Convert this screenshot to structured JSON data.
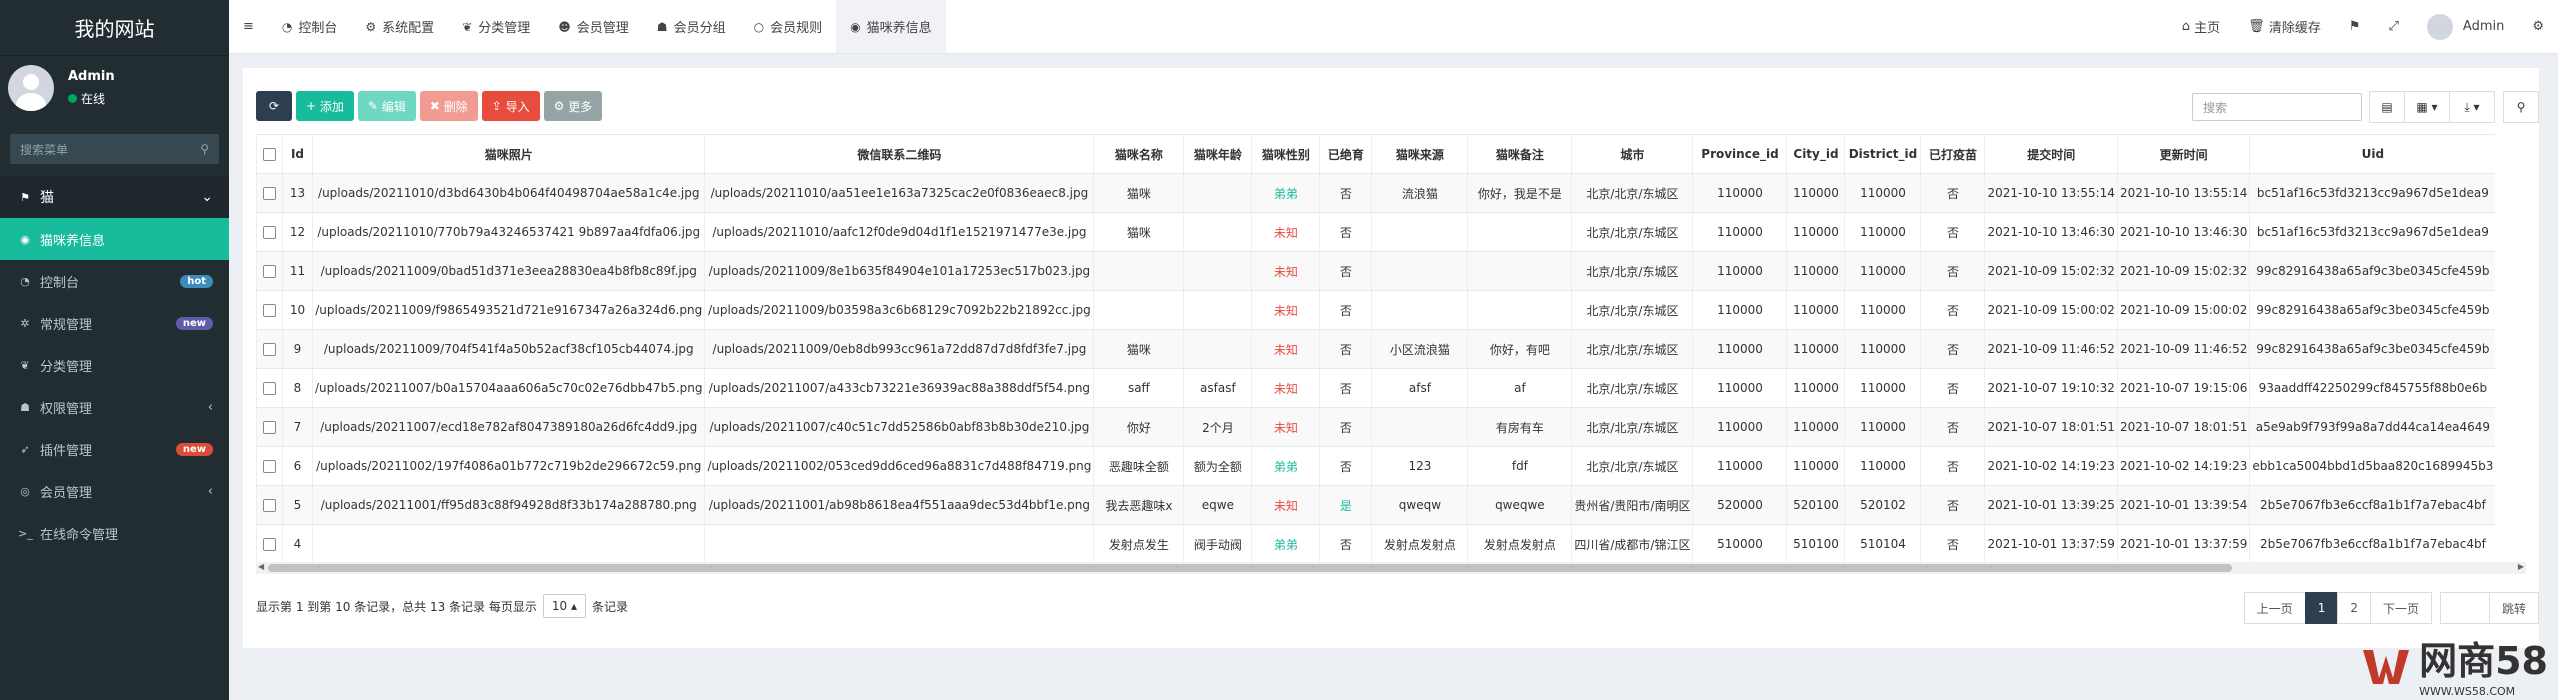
{
  "sidebar": {
    "site_title": "我的网站",
    "user": {
      "name": "Admin",
      "status": "在线"
    },
    "search_placeholder": "搜索菜单",
    "items": [
      {
        "label": "猫",
        "icon": "cat-icon",
        "glyph": "⚑"
      },
      {
        "label": "猫咪养信息",
        "icon": "wechat-icon",
        "glyph": "◉"
      },
      {
        "label": "控制台",
        "icon": "dashboard-icon",
        "glyph": "◔",
        "badge": "hot",
        "badge_color": "#3c8dbc"
      },
      {
        "label": "常规管理",
        "icon": "cogs-icon",
        "glyph": "✲",
        "badge": "new",
        "badge_color": "#605ca8"
      },
      {
        "label": "分类管理",
        "icon": "leaf-icon",
        "glyph": "❦"
      },
      {
        "label": "权限管理",
        "icon": "group-icon",
        "glyph": "☗"
      },
      {
        "label": "插件管理",
        "icon": "rocket-icon",
        "glyph": "➶",
        "badge": "new",
        "badge_color": "#dd4b39"
      },
      {
        "label": "会员管理",
        "icon": "user-circle-icon",
        "glyph": "◎"
      },
      {
        "label": "在线命令管理",
        "icon": "terminal-icon",
        "glyph": ">_"
      }
    ]
  },
  "topnav": {
    "tabs": [
      {
        "label": "控制台",
        "icon": "dashboard-icon",
        "glyph": "◔"
      },
      {
        "label": "系统配置",
        "icon": "gear-icon",
        "glyph": "⚙"
      },
      {
        "label": "分类管理",
        "icon": "leaf-icon",
        "glyph": "❦"
      },
      {
        "label": "会员管理",
        "icon": "user-icon",
        "glyph": "☻"
      },
      {
        "label": "会员分组",
        "icon": "users-icon",
        "glyph": "☗"
      },
      {
        "label": "会员规则",
        "icon": "circle-icon",
        "glyph": "○"
      },
      {
        "label": "猫咪养信息",
        "icon": "wechat-icon",
        "glyph": "◉"
      }
    ],
    "right": {
      "home": "主页",
      "clear_cache": "清除缓存",
      "admin": "Admin"
    }
  },
  "toolbar": {
    "add": "添加",
    "edit": "编辑",
    "delete": "删除",
    "import": "导入",
    "more": "更多",
    "search_placeholder": "搜索"
  },
  "table": {
    "columns": [
      "Id",
      "猫咪照片",
      "微信联系二维码",
      "猫咪名称",
      "猫咪年龄",
      "猫咪性别",
      "已绝育",
      "猫咪来源",
      "猫咪备注",
      "城市",
      "Province_id",
      "City_id",
      "District_id",
      "已打疫苗",
      "提交时间",
      "更新时间",
      "Uid"
    ],
    "rows": [
      [
        "13",
        "/uploads/20211010/d3bd6430b4b064f40498704ae58a1c4e.jpg",
        "/uploads/20211010/aa51ee1e163a7325cac2e0f0836eaec8.jpg",
        "猫咪",
        "",
        "弟弟",
        "否",
        "流浪猫",
        "你好，我是不是",
        "北京/北京/东城区",
        "110000",
        "110000",
        "110000",
        "否",
        "2021-10-10 13:55:14",
        "2021-10-10 13:55:14",
        "bc51af16c53fd3213cc9a967d5e1dea9"
      ],
      [
        "12",
        "/uploads/20211010/770b79a43246537421 9b897aa4fdfa06.jpg",
        "/uploads/20211010/aafc12f0de9d04d1f1e1521971477e3e.jpg",
        "猫咪",
        "",
        "未知",
        "否",
        "",
        "",
        "北京/北京/东城区",
        "110000",
        "110000",
        "110000",
        "否",
        "2021-10-10 13:46:30",
        "2021-10-10 13:46:30",
        "bc51af16c53fd3213cc9a967d5e1dea9"
      ],
      [
        "11",
        "/uploads/20211009/0bad51d371e3eea28830ea4b8fb8c89f.jpg",
        "/uploads/20211009/8e1b635f84904e101a17253ec517b023.jpg",
        "",
        "",
        "未知",
        "否",
        "",
        "",
        "北京/北京/东城区",
        "110000",
        "110000",
        "110000",
        "否",
        "2021-10-09 15:02:32",
        "2021-10-09 15:02:32",
        "99c82916438a65af9c3be0345cfe459b"
      ],
      [
        "10",
        "/uploads/20211009/f9865493521d721e9167347a26a324d6.png",
        "/uploads/20211009/b03598a3c6b68129c7092b22b21892cc.jpg",
        "",
        "",
        "未知",
        "否",
        "",
        "",
        "北京/北京/东城区",
        "110000",
        "110000",
        "110000",
        "否",
        "2021-10-09 15:00:02",
        "2021-10-09 15:00:02",
        "99c82916438a65af9c3be0345cfe459b"
      ],
      [
        "9",
        "/uploads/20211009/704f541f4a50b52acf38cf105cb44074.jpg",
        "/uploads/20211009/0eb8db993cc961a72dd87d7d8fdf3fe7.jpg",
        "猫咪",
        "",
        "未知",
        "否",
        "小区流浪猫",
        "你好，有吧",
        "北京/北京/东城区",
        "110000",
        "110000",
        "110000",
        "否",
        "2021-10-09 11:46:52",
        "2021-10-09 11:46:52",
        "99c82916438a65af9c3be0345cfe459b"
      ],
      [
        "8",
        "/uploads/20211007/b0a15704aaa606a5c70c02e76dbb47b5.png",
        "/uploads/20211007/a433cb73221e36939ac88a388ddf5f54.png",
        "saff",
        "asfasf",
        "未知",
        "否",
        "afsf",
        "af",
        "北京/北京/东城区",
        "110000",
        "110000",
        "110000",
        "否",
        "2021-10-07 19:10:32",
        "2021-10-07 19:15:06",
        "93aaddff42250299cf845755f88b0e6b"
      ],
      [
        "7",
        "/uploads/20211007/ecd18e782af8047389180a26d6fc4dd9.jpg",
        "/uploads/20211007/c40c51c7dd52586b0abf83b8b30de210.jpg",
        "你好",
        "2个月",
        "未知",
        "否",
        "",
        "有房有车",
        "北京/北京/东城区",
        "110000",
        "110000",
        "110000",
        "否",
        "2021-10-07 18:01:51",
        "2021-10-07 18:01:51",
        "a5e9ab9f793f99a8a7dd44ca14ea4649"
      ],
      [
        "6",
        "/uploads/20211002/197f4086a01b772c719b2de296672c59.png",
        "/uploads/20211002/053ced9dd6ced96a8831c7d488f84719.png",
        "恶趣味全额",
        "额为全额",
        "弟弟",
        "否",
        "123",
        "fdf",
        "北京/北京/东城区",
        "110000",
        "110000",
        "110000",
        "否",
        "2021-10-02 14:19:23",
        "2021-10-02 14:19:23",
        "ebb1ca5004bbd1d5baa820c1689945b3"
      ],
      [
        "5",
        "/uploads/20211001/ff95d83c88f94928d8f33b174a288780.png",
        "/uploads/20211001/ab98b8618ea4f551aaa9dec53d4bbf1e.png",
        "我去恶趣味x",
        "eqwe",
        "未知",
        "是",
        "qweqw",
        "qweqwe",
        "贵州省/贵阳市/南明区",
        "520000",
        "520100",
        "520102",
        "否",
        "2021-10-01 13:39:25",
        "2021-10-01 13:39:54",
        "2b5e7067fb3e6ccf8a1b1f7a7ebac4bf"
      ],
      [
        "4",
        "",
        "",
        "发射点发生",
        "阀手动阀",
        "弟弟",
        "否",
        "发射点发射点",
        "发射点发射点",
        "四川省/成都市/锦江区",
        "510000",
        "510100",
        "510104",
        "否",
        "2021-10-01 13:37:59",
        "2021-10-01 13:37:59",
        "2b5e7067fb3e6ccf8a1b1f7a7ebac4bf"
      ]
    ]
  },
  "footer": {
    "info_prefix": "显示第 1 到第 10 条记录，总共 13 条记录 每页显示",
    "page_size": "10 ▴",
    "info_suffix": "条记录",
    "prev": "上一页",
    "page1": "1",
    "page2": "2",
    "next": "下一页",
    "jump": "跳转"
  },
  "watermark": {
    "brand": "网商58",
    "url": "WWW.WS58.COM"
  }
}
